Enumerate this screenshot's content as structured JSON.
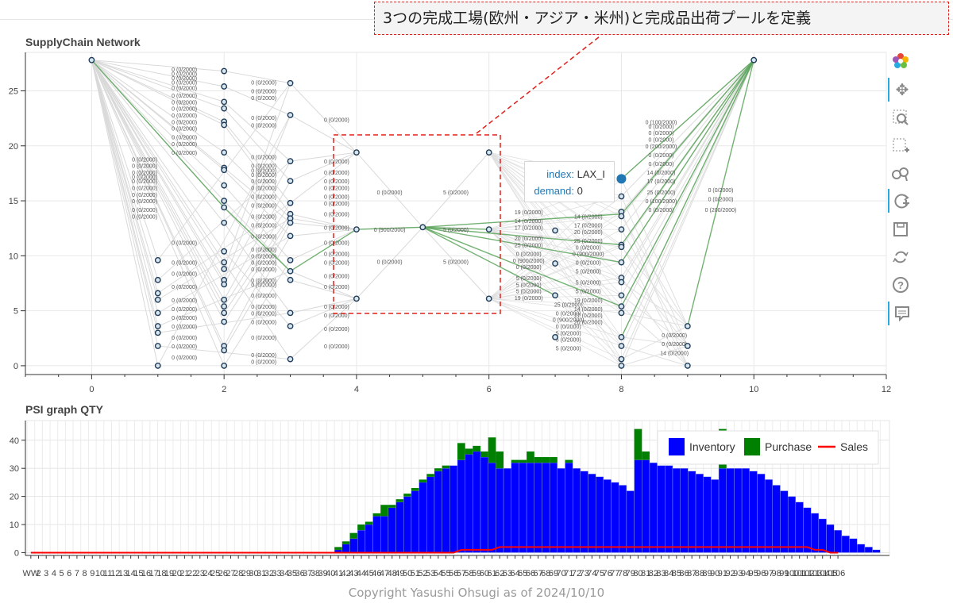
{
  "annotation": "3つの完成工場(欧州・アジア・米州)と完成品出荷プールを定義",
  "copyright": "Copyright Yasushi Ohsugi as of 2024/10/10",
  "tooltip": {
    "index_key": "index:",
    "index_val": "LAX_I",
    "demand_key": "demand:",
    "demand_val": "0"
  },
  "toolbar": [
    "bokeh-logo-icon",
    "pan-icon",
    "box-zoom-icon",
    "box-select-icon",
    "wheel-zoom-icon",
    "reset-icon",
    "save-icon",
    "refresh-icon",
    "help-icon",
    "hover-icon"
  ],
  "chart_data": [
    {
      "type": "scatter",
      "title": "SupplyChain Network",
      "xlim": [
        -1,
        12
      ],
      "ylim": [
        -0.8,
        28.5
      ],
      "xticks": [
        0,
        2,
        4,
        6,
        8,
        10,
        12
      ],
      "yticks": [
        0,
        5,
        10,
        15,
        20,
        25
      ],
      "grid": true,
      "nodes": [
        {
          "x": 0,
          "y": 27.8
        },
        {
          "x": 10,
          "y": 27.8
        },
        {
          "x": 1,
          "y": 9.6
        },
        {
          "x": 1,
          "y": 7.8
        },
        {
          "x": 1,
          "y": 6.6
        },
        {
          "x": 1,
          "y": 6.0
        },
        {
          "x": 1,
          "y": 4.8
        },
        {
          "x": 1,
          "y": 3.6
        },
        {
          "x": 1,
          "y": 3.0
        },
        {
          "x": 1,
          "y": 1.8
        },
        {
          "x": 1,
          "y": 0
        },
        {
          "x": 2,
          "y": 26.8
        },
        {
          "x": 2,
          "y": 25.4
        },
        {
          "x": 2,
          "y": 24.0
        },
        {
          "x": 2,
          "y": 23.4
        },
        {
          "x": 2,
          "y": 22.2
        },
        {
          "x": 2,
          "y": 21.9
        },
        {
          "x": 2,
          "y": 19.4
        },
        {
          "x": 2,
          "y": 18.0
        },
        {
          "x": 2,
          "y": 17.8
        },
        {
          "x": 2,
          "y": 16.4
        },
        {
          "x": 2,
          "y": 15.0
        },
        {
          "x": 2,
          "y": 14.4
        },
        {
          "x": 2,
          "y": 13.0
        },
        {
          "x": 2,
          "y": 10.4
        },
        {
          "x": 2,
          "y": 9.4
        },
        {
          "x": 2,
          "y": 8.8
        },
        {
          "x": 2,
          "y": 7.8
        },
        {
          "x": 2,
          "y": 7.4
        },
        {
          "x": 2,
          "y": 6.0
        },
        {
          "x": 2,
          "y": 5.4
        },
        {
          "x": 2,
          "y": 4.8
        },
        {
          "x": 2,
          "y": 4.0
        },
        {
          "x": 2,
          "y": 1.8
        },
        {
          "x": 2,
          "y": 1.4
        },
        {
          "x": 2,
          "y": 0
        },
        {
          "x": 3,
          "y": 25.7
        },
        {
          "x": 3,
          "y": 22.8
        },
        {
          "x": 3,
          "y": 18.6
        },
        {
          "x": 3,
          "y": 16.8
        },
        {
          "x": 3,
          "y": 14.8
        },
        {
          "x": 3,
          "y": 13.8
        },
        {
          "x": 3,
          "y": 13.4
        },
        {
          "x": 3,
          "y": 13.0
        },
        {
          "x": 3,
          "y": 11.8
        },
        {
          "x": 3,
          "y": 9.6
        },
        {
          "x": 3,
          "y": 8.6
        },
        {
          "x": 3,
          "y": 7.8
        },
        {
          "x": 3,
          "y": 4.8
        },
        {
          "x": 3,
          "y": 3.6
        },
        {
          "x": 3,
          "y": 0.6
        },
        {
          "x": 4,
          "y": 19.4
        },
        {
          "x": 4,
          "y": 12.4
        },
        {
          "x": 4,
          "y": 6.1
        },
        {
          "x": 5,
          "y": 12.6
        },
        {
          "x": 6,
          "y": 19.4
        },
        {
          "x": 6,
          "y": 12.4
        },
        {
          "x": 6,
          "y": 6.1
        },
        {
          "x": 7,
          "y": 12.3
        },
        {
          "x": 7,
          "y": 9.3
        },
        {
          "x": 7,
          "y": 6.4
        },
        {
          "x": 7,
          "y": 2.6
        },
        {
          "x": 8,
          "y": 17.0
        },
        {
          "x": 8,
          "y": 15.4
        },
        {
          "x": 8,
          "y": 14.0
        },
        {
          "x": 8,
          "y": 13.6
        },
        {
          "x": 8,
          "y": 12.4
        },
        {
          "x": 8,
          "y": 11.0
        },
        {
          "x": 8,
          "y": 10.8
        },
        {
          "x": 8,
          "y": 9.4
        },
        {
          "x": 8,
          "y": 8.0
        },
        {
          "x": 8,
          "y": 7.6
        },
        {
          "x": 8,
          "y": 6.4
        },
        {
          "x": 8,
          "y": 5.4
        },
        {
          "x": 8,
          "y": 4.8
        },
        {
          "x": 8,
          "y": 2.6
        },
        {
          "x": 8,
          "y": 1.8
        },
        {
          "x": 8,
          "y": 0.6
        },
        {
          "x": 8,
          "y": 0
        },
        {
          "x": 9,
          "y": 3.6
        },
        {
          "x": 9,
          "y": 1.8
        },
        {
          "x": 9,
          "y": 0
        }
      ],
      "green_paths": [
        [
          [
            0,
            27.8
          ],
          [
            2,
            14.4
          ],
          [
            3,
            8.6
          ],
          [
            4,
            12.4
          ],
          [
            5,
            12.6
          ],
          [
            6,
            12.4
          ]
        ],
        [
          [
            5,
            12.6
          ],
          [
            8,
            13.8
          ]
        ],
        [
          [
            5,
            12.6
          ],
          [
            8,
            11.0
          ]
        ],
        [
          [
            5,
            12.6
          ],
          [
            8,
            9.4
          ]
        ],
        [
          [
            5,
            12.6
          ],
          [
            7,
            6.4
          ]
        ],
        [
          [
            5,
            12.6
          ],
          [
            8,
            5.4
          ]
        ],
        [
          [
            8,
            13.8
          ],
          [
            10,
            27.8
          ]
        ],
        [
          [
            8,
            11.0
          ],
          [
            10,
            27.8
          ]
        ],
        [
          [
            8,
            9.4
          ],
          [
            10,
            27.8
          ]
        ],
        [
          [
            8,
            5.4
          ],
          [
            10,
            27.8
          ]
        ],
        [
          [
            8,
            17.0
          ],
          [
            10,
            27.8
          ]
        ],
        [
          [
            9,
            3.6
          ],
          [
            10,
            27.8
          ]
        ],
        [
          [
            8,
            2.6
          ],
          [
            10,
            27.8
          ]
        ]
      ],
      "edge_labels_left": [
        "0 (0/2000)",
        "0 (0/2000)",
        "0 (0/2000)",
        "0 (0/2000)",
        "0 (0/2000)",
        "0 (0/2000)",
        "0 (0/2000)",
        "0 (0/2000)",
        "0 (0/2000)",
        "0 (0/2000)",
        "0 (0/2000)",
        "0 (0/2000)",
        "0 (0/2000)",
        "0 (0/2000)",
        "0 (0/2000)",
        "0 (0/2000)",
        "0 (0/2000)",
        "0 (0/2000)"
      ],
      "edge_labels_mid": [
        "0 (0/2000)",
        "0 (900/2000)",
        "0 (0/2000)",
        "5 (0/2000)",
        "5 (0/2000)",
        "5 (0/2000)",
        "19 (0/2000)",
        "14 (0/2000)",
        "17 (0/2000)",
        "20 (0/2000)",
        "25 (0/2000)"
      ],
      "edge_labels_right": [
        "0 (100/2000)",
        "0 (0/2000)",
        "0 (0/2000)",
        "0 (0/2000)",
        "0 (200/2000)",
        "0 (0/2000)",
        "0 (0/2000)",
        "14 (0/2000)",
        "17 (0/2000)",
        "25 (0/2000)"
      ]
    },
    {
      "type": "bar",
      "title": "PSI graph QTY",
      "ylim": [
        -1,
        47
      ],
      "yticks": [
        0,
        10,
        20,
        30,
        40
      ],
      "grid": true,
      "legend_position": "top-right",
      "legend": [
        "Inventory",
        "Purchase",
        "Sales"
      ],
      "colors": {
        "inventory": "#0000ff",
        "purchase": "#008000",
        "sales": "#ff0000"
      },
      "week_count": 106,
      "x_tick_labels_sample": [
        "WW",
        "2",
        "3",
        "4",
        "5",
        "6",
        "7",
        "8",
        "9",
        "10",
        "11",
        "12",
        "13",
        "14",
        "15",
        "16",
        "17",
        "18",
        "19",
        "20",
        "21",
        "22",
        "23",
        "24",
        "25",
        "26",
        "27",
        "28",
        "29",
        "30",
        "31",
        "32",
        "33",
        "34",
        "35",
        "36",
        "37",
        "38",
        "39",
        "40",
        "41",
        "42",
        "43",
        "44",
        "45",
        "46",
        "47",
        "48",
        "49",
        "50",
        "51",
        "52",
        "53",
        "54",
        "55",
        "56",
        "57",
        "58",
        "59",
        "60",
        "61",
        "62",
        "63",
        "64",
        "65",
        "66",
        "67",
        "68",
        "69",
        "70",
        "71",
        "72",
        "73",
        "74",
        "75",
        "76",
        "77",
        "78",
        "79",
        "80",
        "81",
        "82",
        "83",
        "84",
        "85",
        "86",
        "87",
        "88",
        "89",
        "90",
        "91",
        "92",
        "93",
        "94",
        "95",
        "96",
        "97",
        "98",
        "99",
        "100",
        "101",
        "102",
        "103",
        "104",
        "105",
        "106"
      ],
      "series": [
        {
          "name": "Inventory",
          "values": [
            0,
            0,
            0,
            0,
            0,
            0,
            0,
            0,
            0,
            0,
            0,
            0,
            0,
            0,
            0,
            0,
            0,
            0,
            0,
            0,
            0,
            0,
            0,
            0,
            0,
            0,
            0,
            0,
            0,
            0,
            0,
            0,
            0,
            0,
            0,
            0,
            0,
            0,
            0,
            0,
            0,
            0,
            0,
            0,
            0,
            0,
            0,
            0,
            0,
            0,
            0,
            0,
            0,
            0,
            0,
            0,
            0,
            0,
            0,
            0,
            0,
            0,
            0,
            0,
            0,
            0,
            0,
            0,
            0,
            0,
            0,
            0,
            0,
            0,
            0,
            0,
            0,
            0,
            0,
            0,
            0,
            0,
            0,
            0,
            0,
            0,
            0,
            0,
            0,
            0,
            0,
            0,
            0,
            0,
            0,
            0,
            0,
            0,
            0,
            0,
            0,
            0,
            0,
            0,
            0,
            0
          ]
        },
        {
          "name": "Purchase",
          "values": []
        },
        {
          "name": "Sales",
          "values": []
        }
      ],
      "inventory": [
        0,
        0,
        0,
        0,
        0,
        0,
        0,
        0,
        0,
        0,
        0,
        0,
        0,
        0,
        0,
        0,
        0,
        0,
        0,
        0,
        0,
        0,
        0,
        0,
        0,
        0,
        0,
        0,
        0,
        0,
        0,
        0,
        0,
        0,
        0,
        0,
        0,
        0,
        0,
        0,
        1,
        3,
        5,
        8,
        10,
        13,
        13,
        16,
        18,
        20,
        22,
        25,
        27,
        29,
        30,
        31,
        33,
        35,
        36,
        34,
        32,
        30,
        30,
        32,
        32,
        32,
        32,
        32,
        32,
        30,
        32,
        30,
        29,
        28,
        27,
        26,
        25,
        24,
        22,
        33,
        33,
        32,
        31,
        31,
        30,
        30,
        29,
        28,
        27,
        26,
        30,
        30,
        30,
        30,
        29,
        28,
        26,
        24,
        22,
        20,
        18,
        16,
        14,
        12,
        10,
        8,
        6,
        5,
        3,
        2,
        1,
        0
      ],
      "purchase": [
        0,
        0,
        0,
        0,
        0,
        0,
        0,
        0,
        0,
        0,
        0,
        0,
        0,
        0,
        0,
        0,
        0,
        0,
        0,
        0,
        0,
        0,
        0,
        0,
        0,
        0,
        0,
        0,
        0,
        0,
        0,
        0,
        0,
        0,
        0,
        0,
        0,
        0,
        0,
        0,
        1,
        1,
        2,
        2,
        1,
        1,
        4,
        1,
        1,
        1,
        1,
        1,
        1,
        1,
        1,
        0,
        6,
        2,
        2,
        2,
        9,
        6,
        0,
        1,
        1,
        4,
        2,
        2,
        2,
        0,
        1,
        0,
        0,
        0,
        0,
        0,
        0,
        0,
        0,
        11,
        3,
        0,
        0,
        0,
        0,
        0,
        0,
        0,
        0,
        0,
        14,
        0,
        0,
        0,
        0,
        0,
        0,
        0,
        0,
        0,
        0,
        0,
        0,
        0,
        0,
        0,
        0,
        0,
        0,
        0,
        0,
        0
      ],
      "sales": [
        0,
        0,
        0,
        0,
        0,
        0,
        0,
        0,
        0,
        0,
        0,
        0,
        0,
        0,
        0,
        0,
        0,
        0,
        0,
        0,
        0,
        0,
        0,
        0,
        0,
        0,
        0,
        0,
        0,
        0,
        0,
        0,
        0,
        0,
        0,
        0,
        0,
        0,
        0,
        0,
        0,
        0,
        0,
        0,
        0,
        0,
        0,
        0,
        0,
        0,
        0,
        0,
        0,
        0,
        0,
        0,
        1,
        1,
        1,
        1,
        1,
        2,
        2,
        2,
        2,
        2,
        2,
        2,
        2,
        2,
        2,
        2,
        2,
        2,
        2,
        2,
        2,
        2,
        2,
        2,
        2,
        2,
        2,
        2,
        2,
        2,
        2,
        2,
        2,
        2,
        2,
        2,
        2,
        2,
        2,
        2,
        2,
        2,
        2,
        2,
        2,
        2,
        1,
        1,
        0,
        0
      ]
    }
  ]
}
